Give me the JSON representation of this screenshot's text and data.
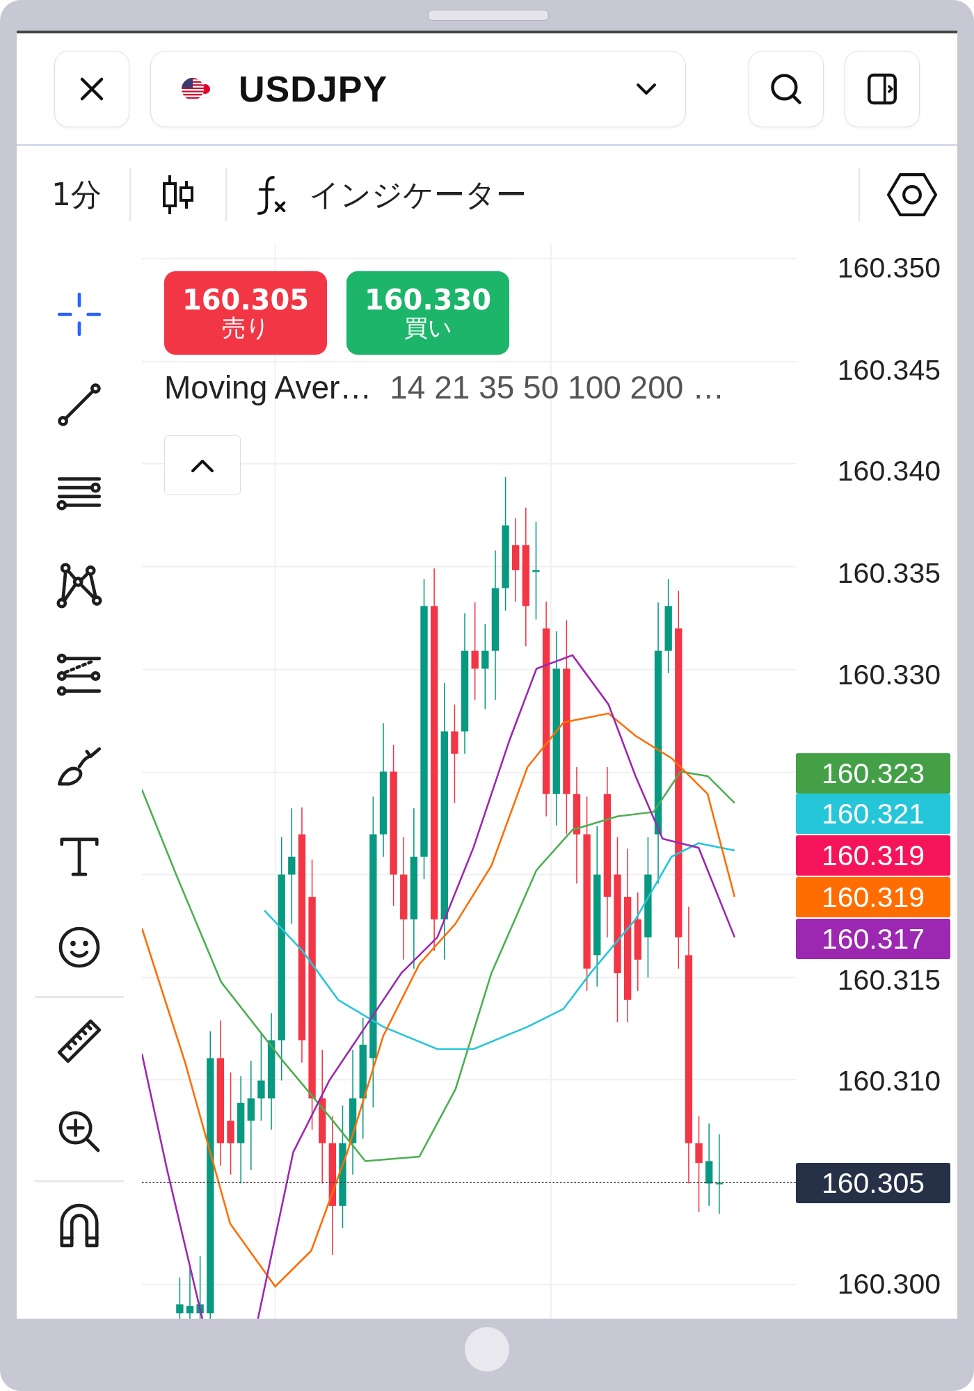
{
  "header": {
    "symbol": "USDJPY"
  },
  "toolbar": {
    "interval": "1分",
    "indicators_label": "インジケーター"
  },
  "tool_groups": [
    {
      "tools": [
        {
          "kind": "crosshair",
          "selected": true
        },
        {
          "kind": "trend-line",
          "selected": false
        },
        {
          "kind": "horizontal-lines",
          "selected": false
        },
        {
          "kind": "pattern",
          "selected": false
        },
        {
          "kind": "channel",
          "selected": false
        },
        {
          "kind": "brush",
          "selected": false
        },
        {
          "kind": "text",
          "selected": false
        },
        {
          "kind": "emoji",
          "selected": false
        }
      ]
    },
    {
      "tools": [
        {
          "kind": "ruler",
          "selected": false
        },
        {
          "kind": "zoom",
          "selected": false
        }
      ]
    },
    {
      "tools": [
        {
          "kind": "magnet",
          "selected": false
        }
      ]
    }
  ],
  "trade_buttons": [
    {
      "kind": "sell",
      "price": "160.305",
      "label": "売り"
    },
    {
      "kind": "buy",
      "price": "160.330",
      "label": "買い"
    }
  ],
  "legend": {
    "name": "Moving Aver…",
    "values": "14 21 35 50 100 200 …"
  },
  "price_axis": [
    {
      "kind": "tick",
      "label": "160.350"
    },
    {
      "kind": "tick",
      "label": "160.345"
    },
    {
      "kind": "tick",
      "label": "160.340"
    },
    {
      "kind": "tick",
      "label": "160.335"
    },
    {
      "kind": "tick",
      "label": "160.330"
    },
    {
      "kind": "tag",
      "label": "160.323",
      "color": "#43a047"
    },
    {
      "kind": "tag",
      "label": "160.321",
      "color": "#26c6da"
    },
    {
      "kind": "tag",
      "label": "160.319",
      "color": "#f5145a"
    },
    {
      "kind": "tag",
      "label": "160.319",
      "color": "#ff6d00"
    },
    {
      "kind": "tag",
      "label": "160.317",
      "color": "#9c27b0"
    },
    {
      "kind": "tick",
      "label": "160.315"
    },
    {
      "kind": "tick",
      "label": "160.310"
    },
    {
      "kind": "tag",
      "label": "160.305",
      "color": "#263148"
    },
    {
      "kind": "tick",
      "label": "160.300"
    }
  ]
}
